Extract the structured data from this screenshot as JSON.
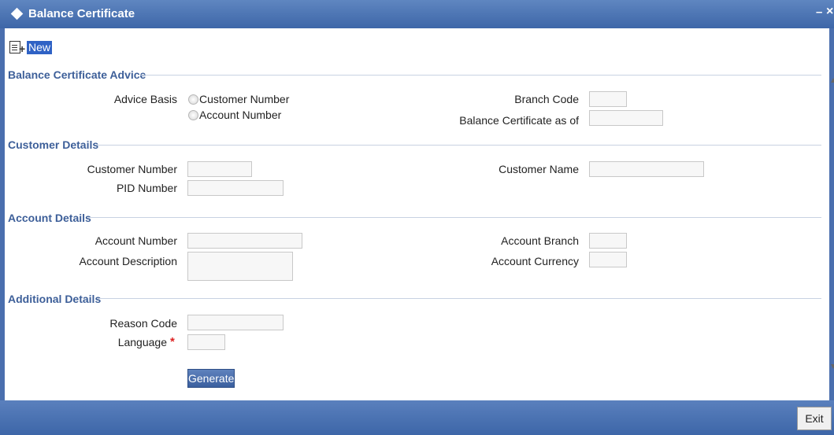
{
  "window": {
    "title": "Balance Certificate",
    "minimize": "–",
    "close": "×"
  },
  "toolbar": {
    "new_label": "New"
  },
  "sections": {
    "advice": "Balance Certificate Advice",
    "customer": "Customer Details",
    "account": "Account Details",
    "additional": "Additional Details"
  },
  "advice": {
    "advice_basis_label": "Advice Basis",
    "options": [
      "Customer Number",
      "Account Number"
    ],
    "branch_code_label": "Branch Code",
    "branch_code_value": "",
    "as_of_label": "Balance Certificate as of",
    "as_of_value": ""
  },
  "customer": {
    "number_label": "Customer Number",
    "number_value": "",
    "pid_label": "PID Number",
    "pid_value": "",
    "name_label": "Customer Name",
    "name_value": ""
  },
  "account": {
    "number_label": "Account Number",
    "number_value": "",
    "description_label": "Account Description",
    "description_value": "",
    "branch_label": "Account Branch",
    "branch_value": "",
    "currency_label": "Account Currency",
    "currency_value": ""
  },
  "additional": {
    "reason_label": "Reason Code",
    "reason_value": "",
    "language_label": "Language",
    "language_required": "*",
    "language_value": ""
  },
  "buttons": {
    "generate": "Generate",
    "exit": "Exit"
  }
}
